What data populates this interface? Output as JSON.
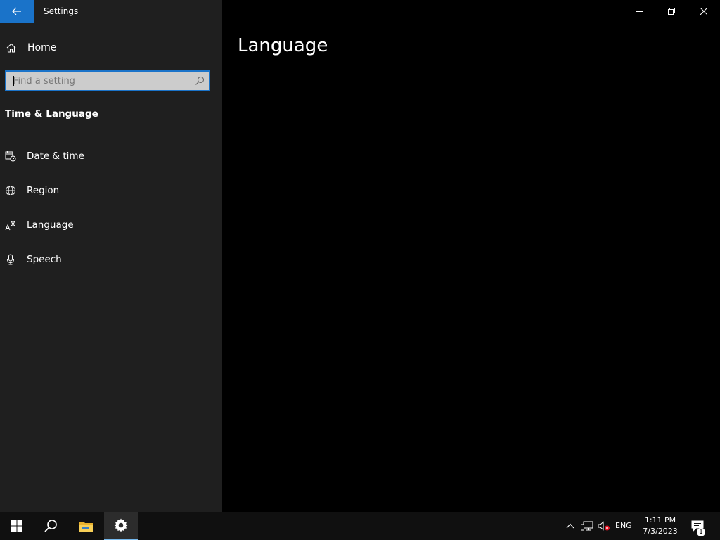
{
  "window": {
    "app_title": "Settings",
    "back_icon": "back-arrow-icon"
  },
  "sidebar": {
    "home": {
      "label": "Home",
      "icon": "home-icon"
    },
    "search": {
      "placeholder": "Find a setting",
      "value": "",
      "icon": "search-icon"
    },
    "section_title": "Time & Language",
    "items": [
      {
        "label": "Date & time",
        "icon": "calendar-clock-icon"
      },
      {
        "label": "Region",
        "icon": "globe-icon"
      },
      {
        "label": "Language",
        "icon": "language-icon"
      },
      {
        "label": "Speech",
        "icon": "microphone-icon"
      }
    ]
  },
  "main": {
    "title": "Language"
  },
  "window_controls": [
    "minimize-icon",
    "restore-icon",
    "close-icon"
  ],
  "taskbar": {
    "pinned": [
      "windows-logo-icon",
      "search-icon",
      "file-explorer-icon",
      "settings-gear-icon"
    ],
    "active_app": "Settings",
    "tray": {
      "language": "ENG",
      "time": "1:11 PM",
      "date": "7/3/2023",
      "notification_count": "1"
    }
  },
  "colors": {
    "accent": "#1a73c9",
    "sidebar_bg": "#1f1f1f",
    "main_bg": "#000000",
    "taskbar_bg": "#101010",
    "taskbar_active_underline": "#76b9ed"
  }
}
